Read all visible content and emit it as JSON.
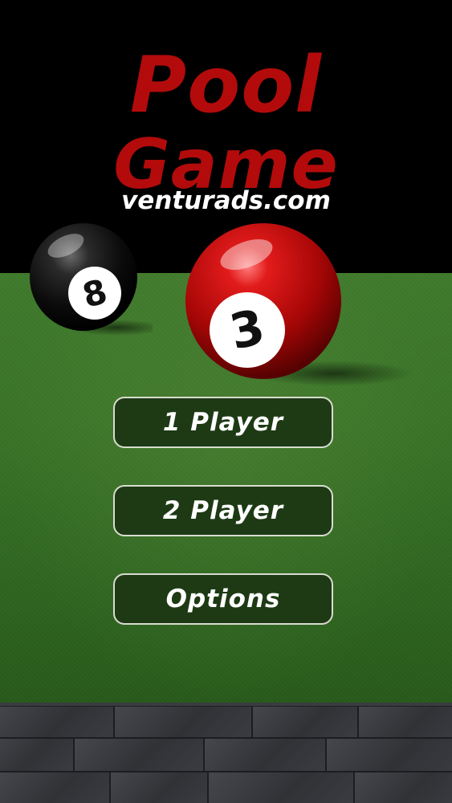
{
  "title": {
    "line1": "Pool",
    "line2": "Game",
    "site": "venturads.com"
  },
  "balls": [
    {
      "number": "8",
      "color": "#000000"
    },
    {
      "number": "3",
      "color": "#c40d0d"
    }
  ],
  "menu": {
    "one_player": "1 Player",
    "two_player": "2 Player",
    "options": "Options"
  },
  "colors": {
    "title_red": "#b30b0b",
    "felt_green": "#3a7428",
    "button_bg": "#1d3a14",
    "button_border": "#d8dcd0"
  }
}
